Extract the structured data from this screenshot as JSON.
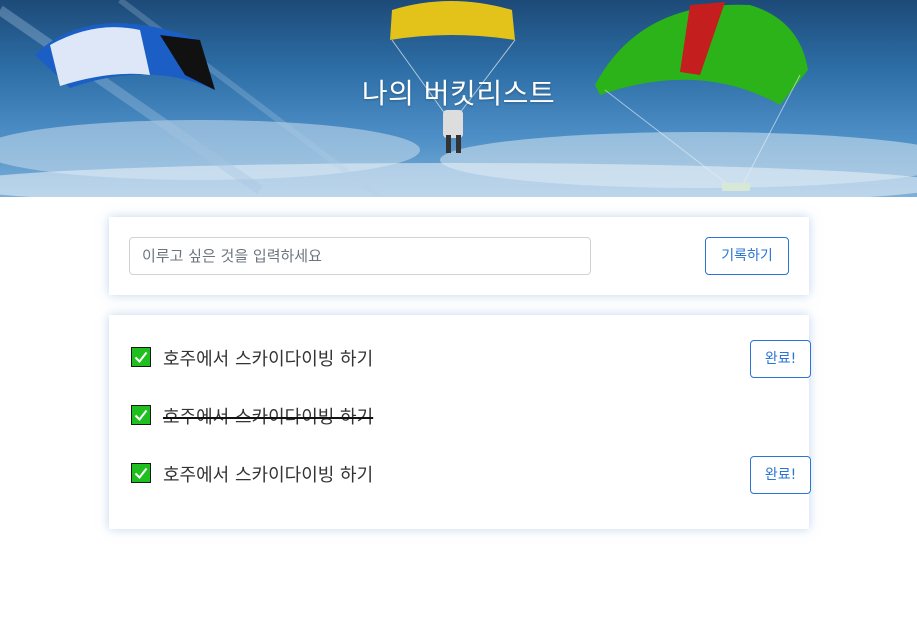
{
  "header": {
    "title": "나의 버킷리스트"
  },
  "form": {
    "placeholder": "이루고 싶은 것을 입력하세요",
    "value": "",
    "submit_label": "기록하기"
  },
  "list": {
    "items": [
      {
        "text": "호주에서 스카이다이빙 하기",
        "done": false,
        "button_label": "완료!"
      },
      {
        "text": "호주에서 스카이다이빙 하기",
        "done": true
      },
      {
        "text": "호주에서 스카이다이빙 하기",
        "done": false,
        "button_label": "완료!"
      }
    ]
  },
  "colors": {
    "accent": "#2a74d6",
    "checkbox": "#1fbf1f"
  },
  "icons": {
    "checkbox": "check-icon"
  }
}
